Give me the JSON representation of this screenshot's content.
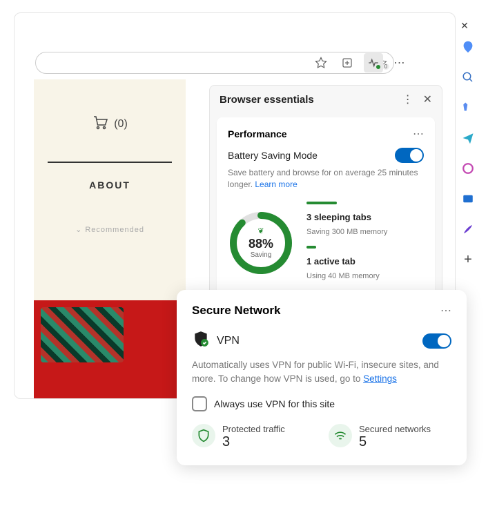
{
  "window": {
    "minimize": "−",
    "maximize": "▢",
    "close": "✕"
  },
  "toolbar": {
    "star_badge": "0"
  },
  "page": {
    "cart_count": "(0)",
    "about": "ABOUT",
    "recommended": "Recommended"
  },
  "panel": {
    "title": "Browser essentials",
    "performance": {
      "title": "Performance",
      "mode_label": "Battery Saving Mode",
      "description": "Save battery and browse for on average 25 minutes longer. ",
      "learn_more": "Learn more",
      "gauge_pct": "88%",
      "gauge_sub": "Saving",
      "sleeping_title": "3 sleeping tabs",
      "sleeping_sub": "Saving 300 MB memory",
      "active_title": "1 active tab",
      "active_sub": "Using 40 MB memory"
    }
  },
  "secure": {
    "title": "Secure Network",
    "vpn_label": "VPN",
    "description_prefix": "Automatically uses VPN for public Wi-Fi, insecure sites, and more. To change how VPN is used, go to ",
    "settings": "Settings",
    "checkbox_label": "Always use VPN for this site",
    "protected_label": "Protected traffic",
    "protected_value": "3",
    "secured_label": "Secured networks",
    "secured_value": "5"
  }
}
